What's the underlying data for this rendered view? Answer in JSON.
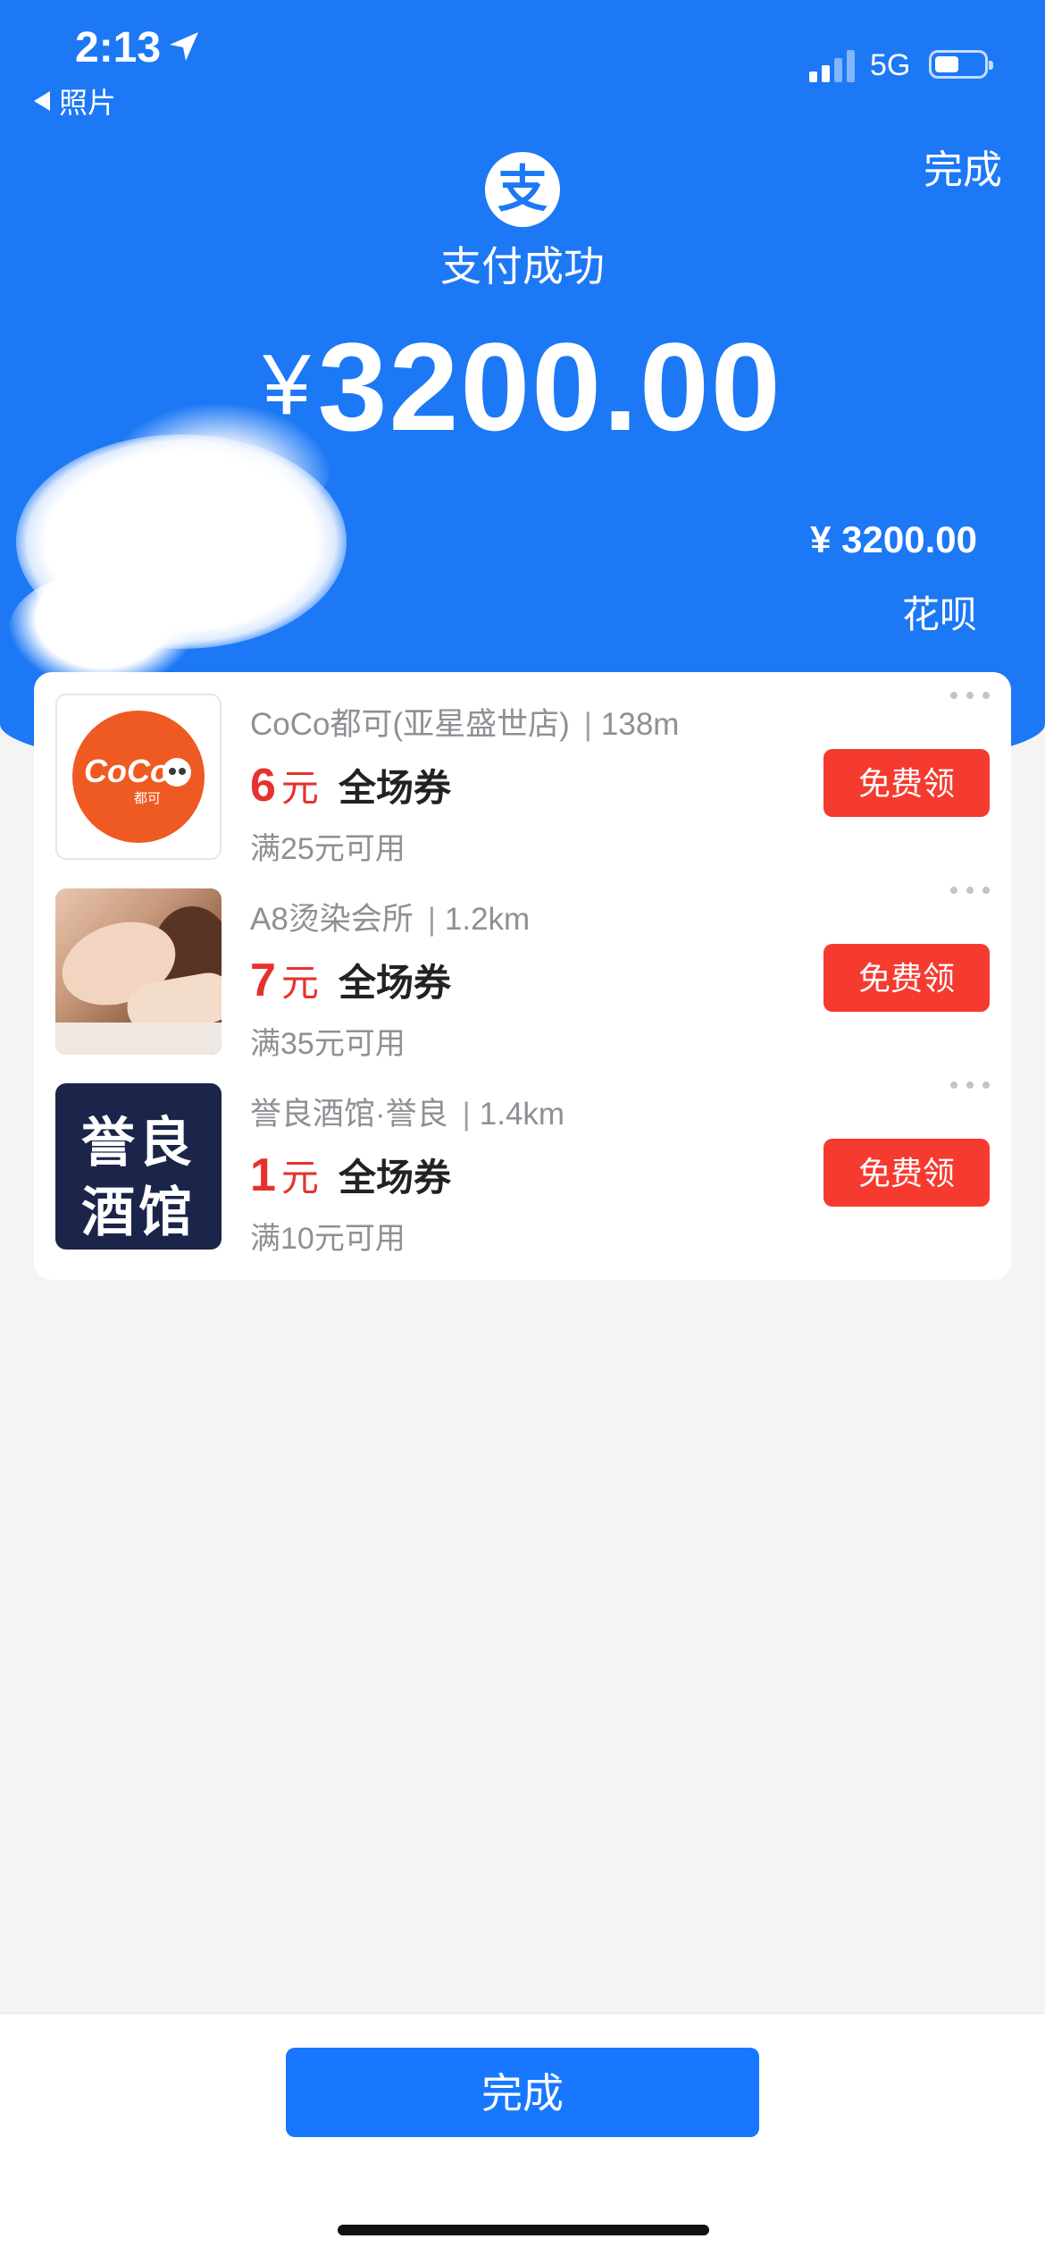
{
  "status_bar": {
    "time": "2:13",
    "back_label": "照片",
    "network": "5G"
  },
  "header": {
    "done_label": "完成",
    "logo_glyph": "支",
    "title": "支付成功",
    "currency_symbol": "¥",
    "amount": "3200.00",
    "detail_amount": "¥ 3200.00",
    "payment_method": "花呗",
    "brand_color": "#1c78f5"
  },
  "coupons": [
    {
      "merchant": "CoCo都可(亚星盛世店)",
      "distance": "138m",
      "value": "6",
      "unit": "元",
      "type": "全场券",
      "condition": "满25元可用",
      "button": "免费领",
      "logo_text": "CoCo",
      "logo_sub": "都可"
    },
    {
      "merchant": "A8烫染会所",
      "distance": "1.2km",
      "value": "7",
      "unit": "元",
      "type": "全场券",
      "condition": "满35元可用",
      "button": "免费领"
    },
    {
      "merchant": "誉良酒馆·誉良",
      "distance": "1.4km",
      "value": "1",
      "unit": "元",
      "type": "全场券",
      "condition": "满10元可用",
      "button": "免费领",
      "logo_line1": "誉良",
      "logo_line2": "酒馆"
    }
  ],
  "footer": {
    "done_label": "完成"
  },
  "colors": {
    "accent": "#1778ff",
    "coupon_red": "#e5322e",
    "claim_button": "#f53a2f"
  }
}
